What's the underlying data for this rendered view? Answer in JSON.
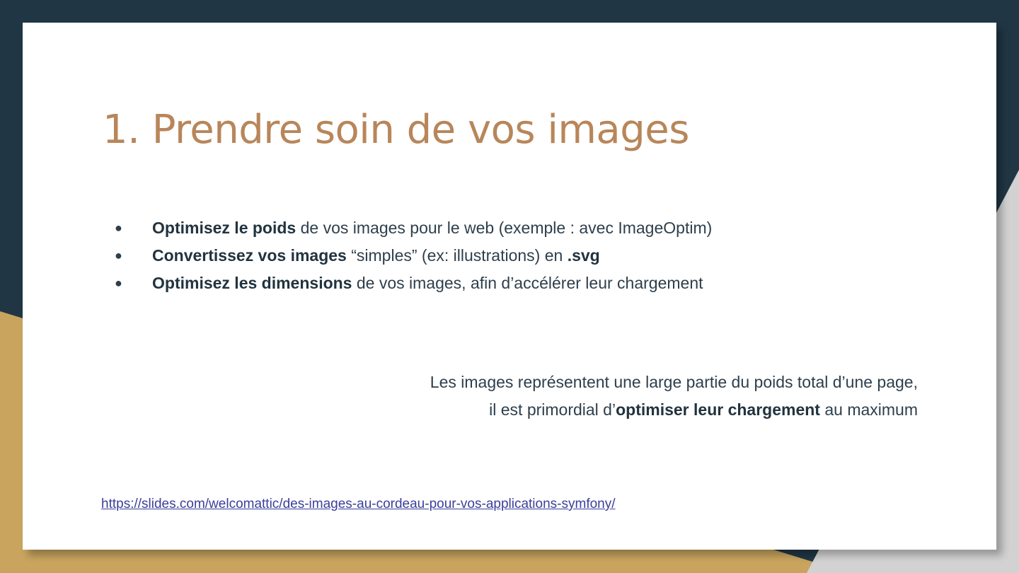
{
  "slide": {
    "title": "1. Prendre soin de vos images",
    "bullets": [
      {
        "bold": "Optimisez le poids",
        "rest": " de vos images pour le web (exemple : avec ImageOptim)"
      },
      {
        "bold": "Convertissez vos images",
        "rest": " “simples” (ex: illustrations) en ",
        "bold2": ".svg"
      },
      {
        "bold": "Optimisez les dimensions",
        "rest": " de vos images, afin d’accélérer leur chargement"
      }
    ],
    "bullet_glyph": "●",
    "quote": {
      "line1": "Les images représentent une large partie du poids total d’une page,",
      "line2_prefix": "il est primordial d’",
      "line2_bold": "optimiser leur chargement",
      "line2_suffix": " au maximum"
    },
    "link": "https://slides.com/welcomattic/des-images-au-cordeau-pour-vos-applications-symfony/"
  },
  "colors": {
    "background_dark": "#213645",
    "background_gold": "#c8a45e",
    "background_gray": "#d2d2d2",
    "title": "#b8865a",
    "text": "#2e3f4c",
    "link": "#3a3f9a"
  }
}
